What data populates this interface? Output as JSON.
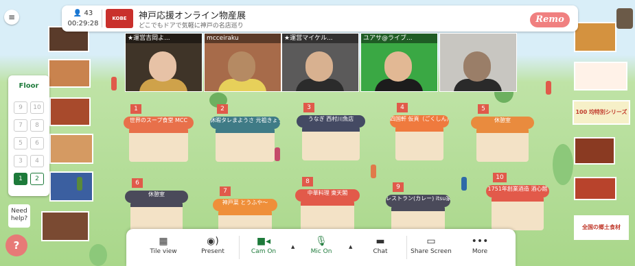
{
  "header": {
    "user_count": "43",
    "timer": "00:29:28",
    "logo_text": "KOBE",
    "event_title": "神戸応援オンライン物産展",
    "event_subtitle": "どこでもドアで気軽に神戸の名店巡り",
    "brand": "Remo"
  },
  "videos": [
    {
      "name": "★運営吉岡よ...",
      "bg": "#3f3428",
      "face": "#e7c2a6",
      "shirt": "#cfa24a"
    },
    {
      "name": "mcceiraku",
      "bg": "#a76b4a",
      "face": "#b58a63",
      "shirt": "#e7d05a"
    },
    {
      "name": "★運営マイケル...",
      "bg": "#5b5a5a",
      "face": "#d8b190",
      "shirt": "#2b2b2b"
    },
    {
      "name": "ユアサ@ライブ...",
      "bg": "#3aa844",
      "face": "#e2b894",
      "shirt": "#1c1c1c"
    },
    {
      "name": "",
      "bg": "#c8c6c1",
      "face": "#9a7e68",
      "shirt": "#2a2a2a"
    }
  ],
  "floor": {
    "title": "Floor",
    "buttons": [
      "9",
      "10",
      "7",
      "8",
      "5",
      "6",
      "3",
      "4",
      "1",
      "2"
    ],
    "active": "1",
    "selected": "2"
  },
  "need_help": "Need help?",
  "help_icon": "?",
  "tables": [
    {
      "num": "1",
      "label": "世界のスープ食堂 MCC",
      "color": "#e8704a"
    },
    {
      "num": "2",
      "label": "休暇タレまようさ 元祖きょうさ商",
      "color": "#3f7b86"
    },
    {
      "num": "3",
      "label": "うなぎ 西村川魚店",
      "color": "#444a63"
    },
    {
      "num": "4",
      "label": "四国軒 仮頁（ごくしん）",
      "color": "#ef7a3e"
    },
    {
      "num": "5",
      "label": "休憩室",
      "color": "#e98b3e"
    },
    {
      "num": "6",
      "label": "休憩室",
      "color": "#4a4a5a"
    },
    {
      "num": "7",
      "label": "神戸菜 とうふや～",
      "color": "#ef8f3a"
    },
    {
      "num": "8",
      "label": "中華料理 東天閣",
      "color": "#e25a4a"
    },
    {
      "num": "9",
      "label": "レストラン(カレー) itsu家",
      "color": "#4a4a5a"
    },
    {
      "num": "10",
      "label": "1751年創業酒造 酒心館",
      "color": "#e25a4a"
    }
  ],
  "toolbar": {
    "tile_view": "Tile view",
    "present": "Present",
    "cam_on": "Cam On",
    "mic_on": "Mic On",
    "chat": "Chat",
    "share_screen": "Share Screen",
    "more": "More"
  },
  "side_ads_right": [
    "100 均特別シリーズ",
    "全国の郷土食材"
  ]
}
